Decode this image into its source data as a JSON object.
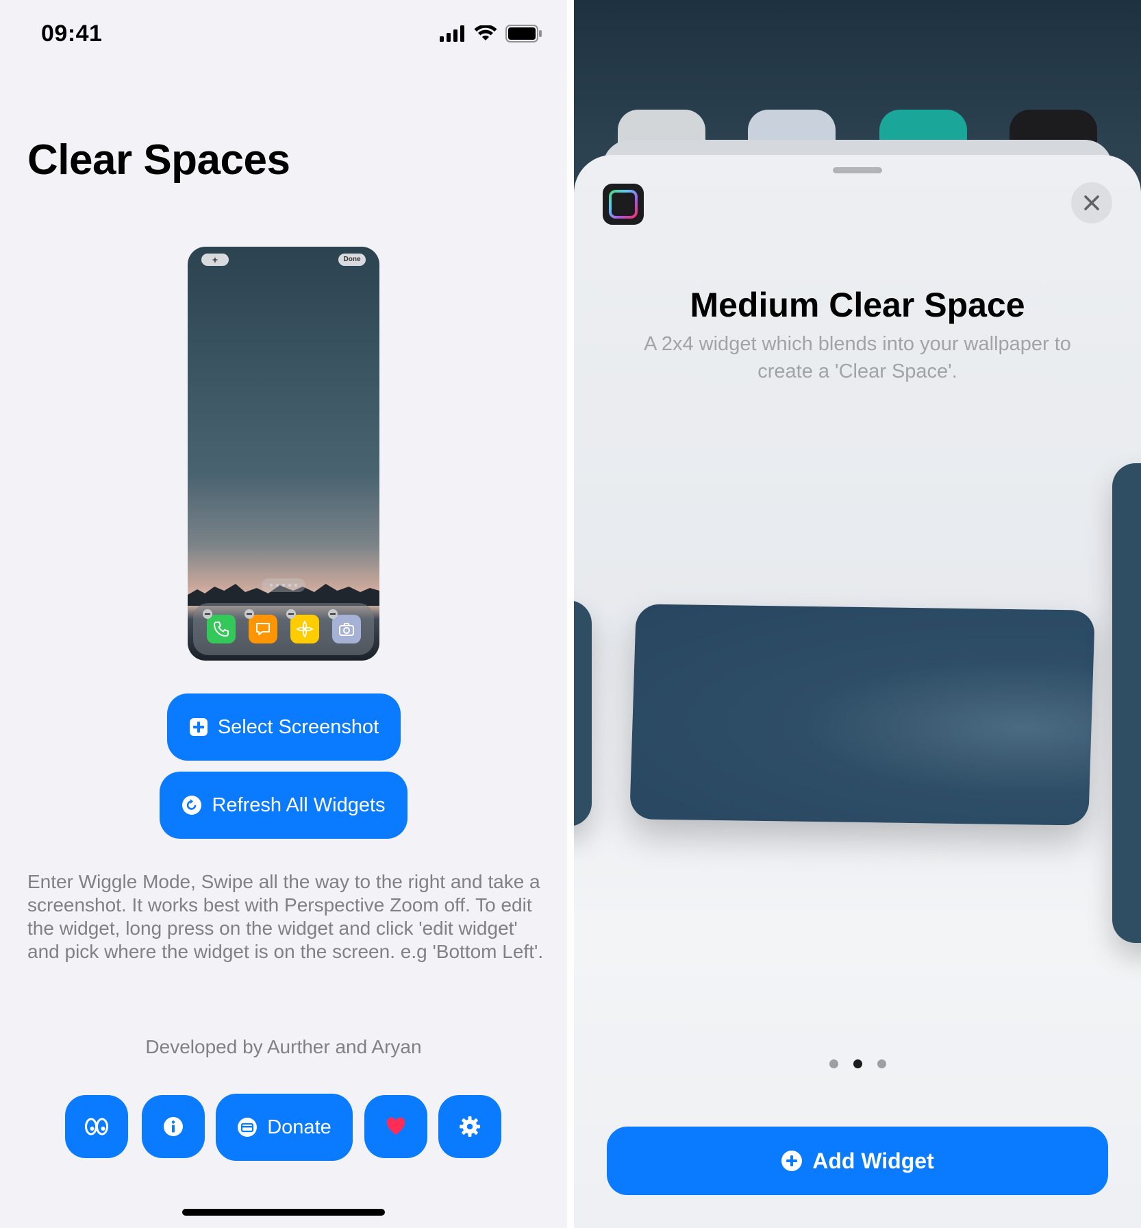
{
  "status_bar": {
    "time": "09:41"
  },
  "left": {
    "title": "Clear Spaces",
    "preview": {
      "plus_label": "+",
      "done_label": "Done"
    },
    "buttons": {
      "select_screenshot": "Select Screenshot",
      "refresh_all_widgets": "Refresh All Widgets",
      "donate": "Donate"
    },
    "instructions": "Enter Wiggle Mode, Swipe all the way to the right and take a screenshot. It works best with Perspective Zoom off. To edit the widget, long press on the widget and click 'edit widget' and pick where the widget is on the screen. e.g 'Bottom Left'.",
    "credit": "Developed by Aurther and Aryan",
    "bottom_actions": [
      {
        "icon": "eyes-icon"
      },
      {
        "icon": "info-icon"
      },
      {
        "icon": "donate-icon",
        "label": "Donate"
      },
      {
        "icon": "heart-icon"
      },
      {
        "icon": "gear-icon"
      }
    ]
  },
  "right": {
    "widget_title": "Medium Clear Space",
    "widget_description": "A 2x4 widget which blends into your wallpaper to create a 'Clear Space'.",
    "page_indicator": {
      "count": 3,
      "active": 2
    },
    "add_widget_label": "Add Widget"
  },
  "colors": {
    "accent": "#0a7aff",
    "background": "#f2f2f7",
    "secondary_text": "#808086",
    "heart": "#ff2d55"
  }
}
